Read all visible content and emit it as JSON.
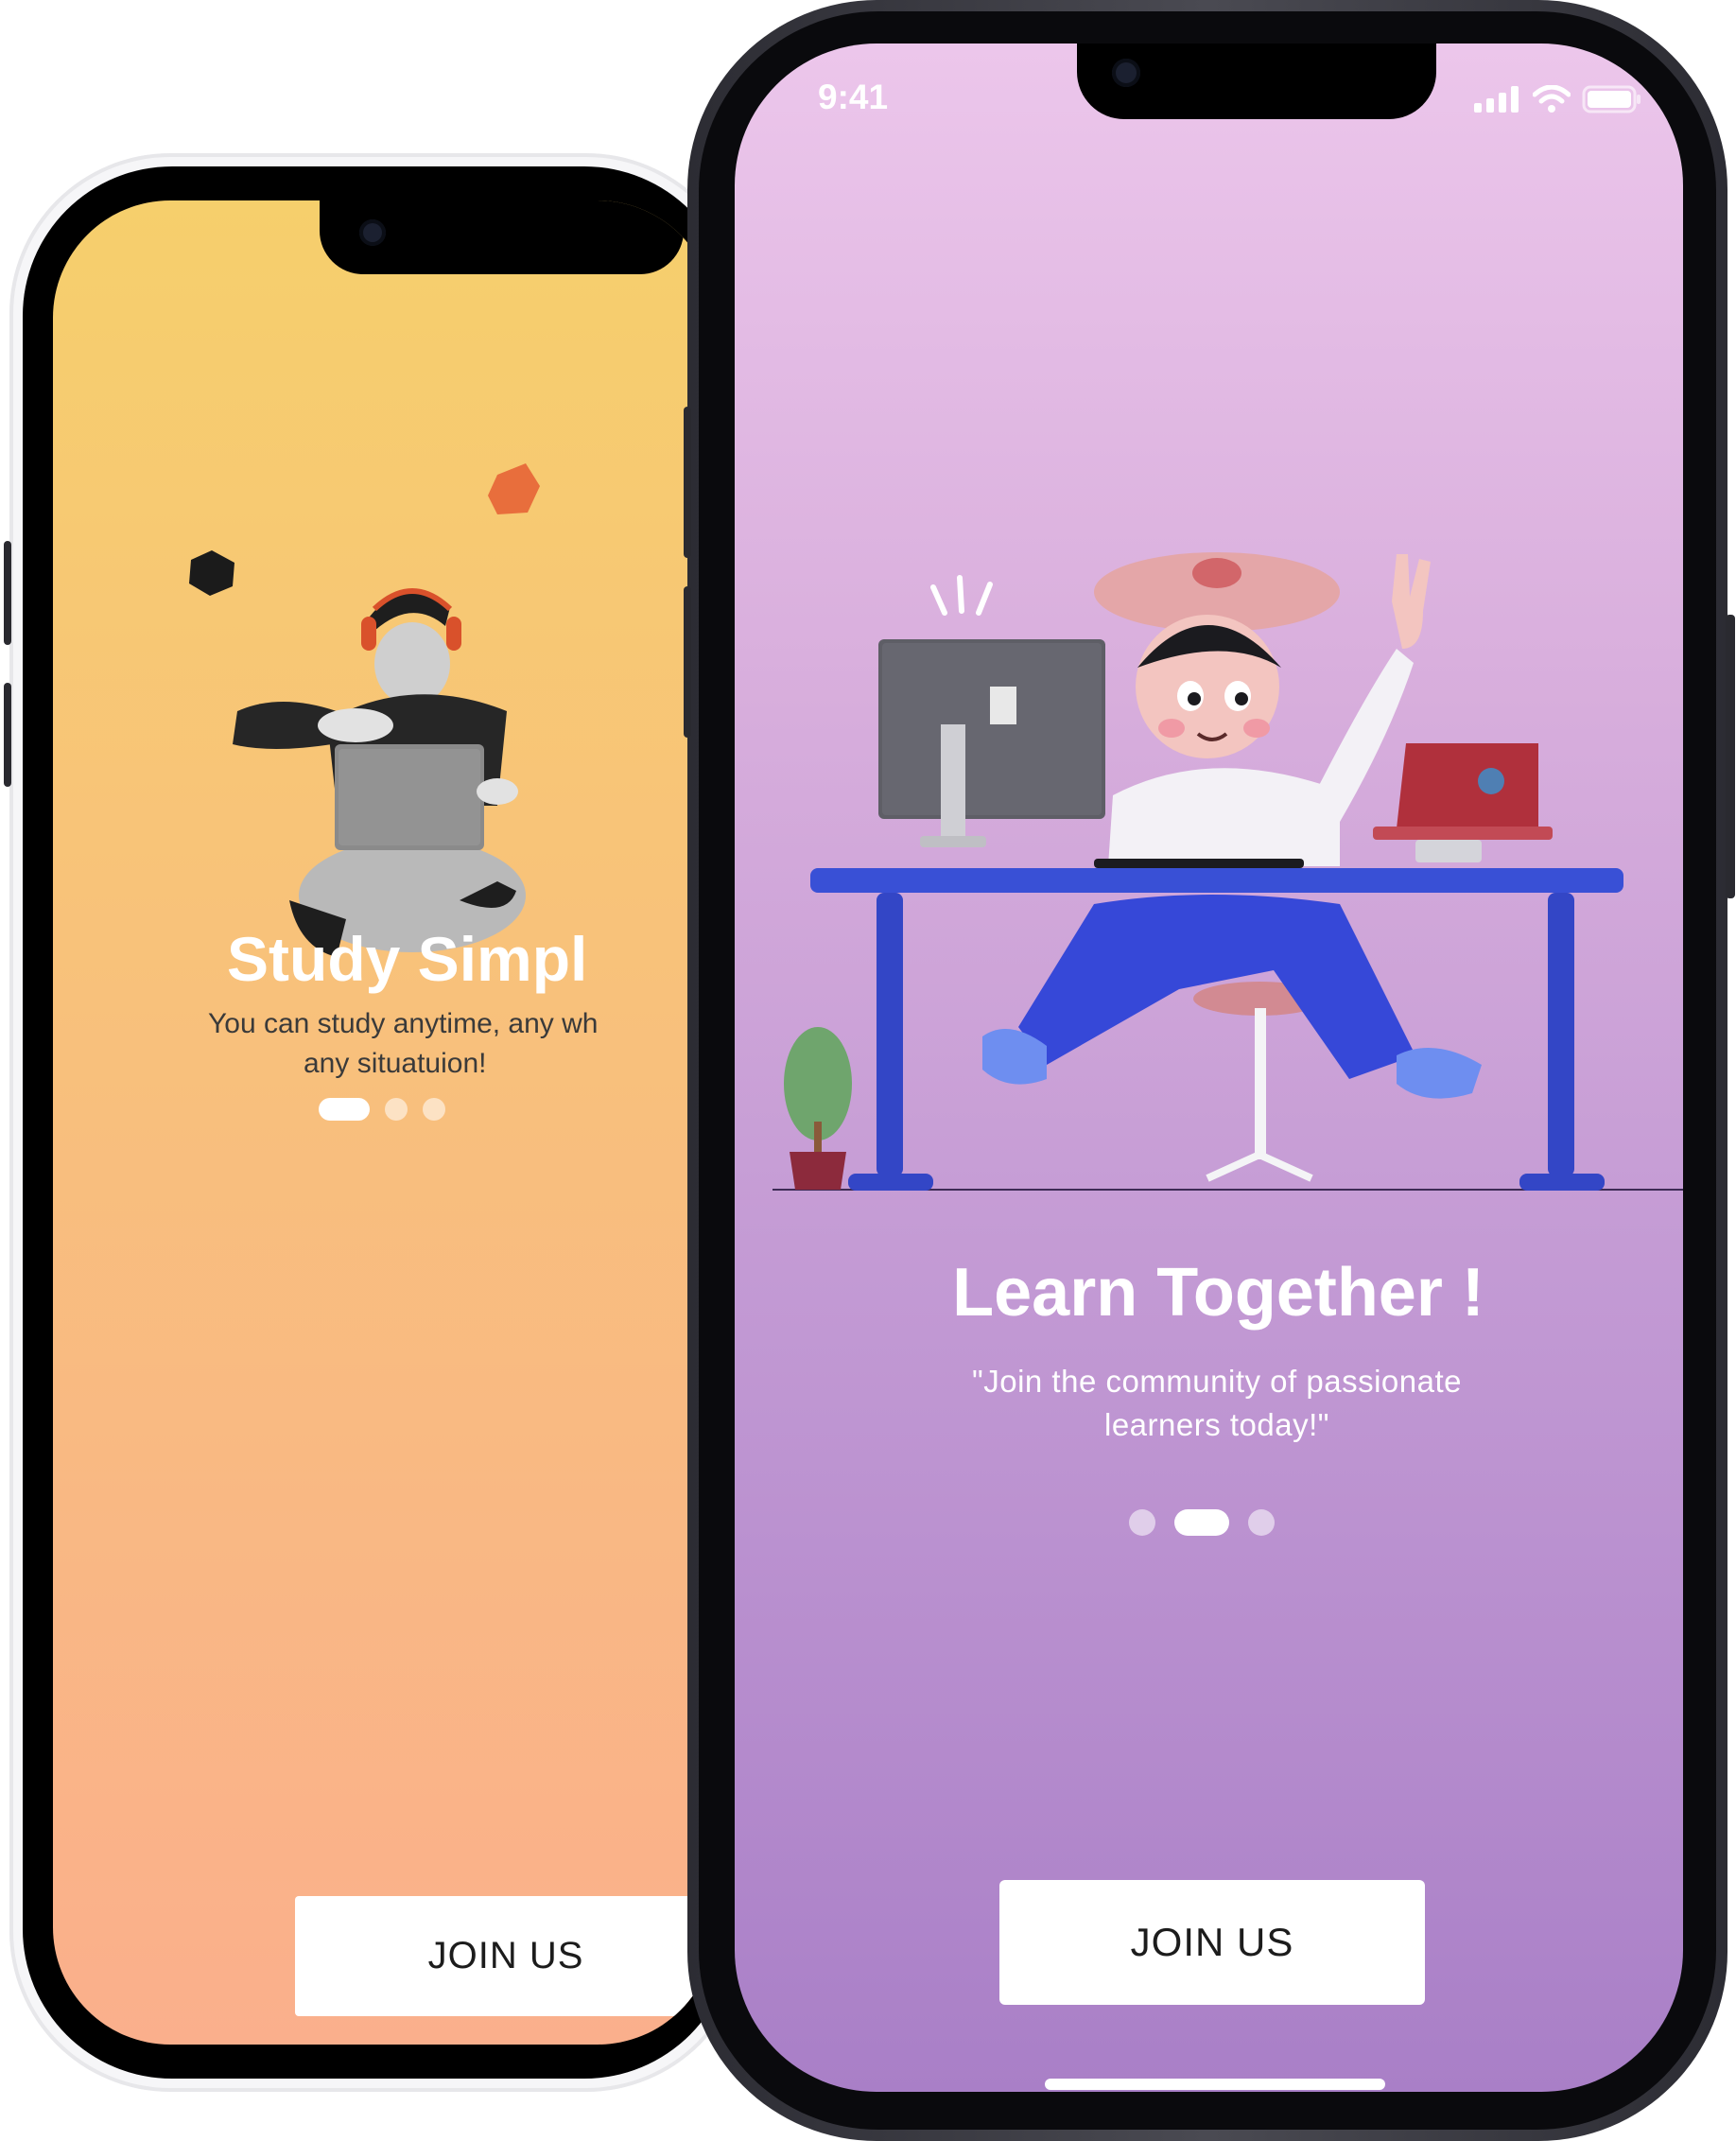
{
  "back_screen": {
    "title": "Study Simpl",
    "subtitle_line1": "You can study anytime, any wh",
    "subtitle_line2": "any situatuion!",
    "page_indicator": {
      "total": 3,
      "active": 1
    },
    "button_label": "JOIN US",
    "colors": {
      "gradient_top": "#f6cf6c",
      "gradient_bottom": "#faaf8c"
    }
  },
  "front_screen": {
    "status_bar": {
      "time": "9:41"
    },
    "title": "Learn Together !",
    "subtitle_line1": "\"Join the community of passionate",
    "subtitle_line2": "learners today!\"",
    "page_indicator": {
      "total": 3,
      "active": 2
    },
    "button_label": "JOIN US",
    "colors": {
      "gradient_top": "#ecc6eb",
      "gradient_bottom": "#a97fc7"
    }
  }
}
